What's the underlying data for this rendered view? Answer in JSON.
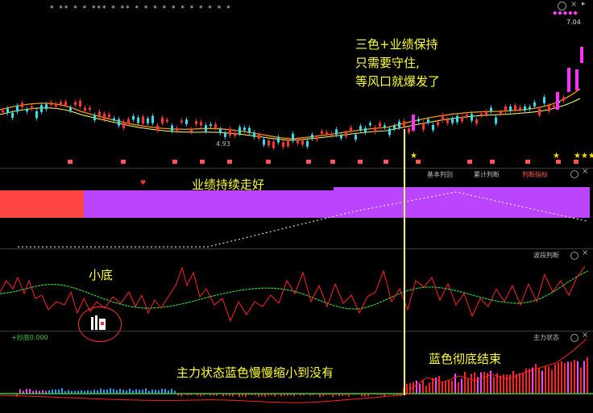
{
  "top_marks": {
    "stars": "*  **   *   *  ***  *   **   *          *   *      *    *   *   *      *   *   *   *"
  },
  "price_panel": {
    "low_label": "4.93",
    "high_label": "7.04",
    "candles_up": "#ff3333",
    "candles_down": "#33ddee",
    "spike_color": "#ff33ff"
  },
  "annotations": {
    "top_line1": "三色+业绩保持",
    "top_line2": "只需要守住,",
    "top_line3": "等风口就爆发了",
    "mid": "业绩持续走好",
    "xiaodi": "小底",
    "bottom_main": "主力状态蓝色慢慢缩小到没有",
    "bottom_end": "蓝色彻底结束"
  },
  "perf_panel": {
    "tab1": "基本判别",
    "tab2": "累计判断",
    "tab3": "判断指标",
    "red_color": "#ff4444",
    "purple_color": "#bb44ff"
  },
  "osc_panel": {
    "title": "波段判断"
  },
  "main_panel": {
    "title": "主力状态",
    "left_label": "+抄底0.000"
  },
  "colors": {
    "line_yellow": "#ffff66",
    "ma_orange": "#ff9900",
    "osc_green": "#33cc33",
    "osc_red": "#ff2222"
  }
}
